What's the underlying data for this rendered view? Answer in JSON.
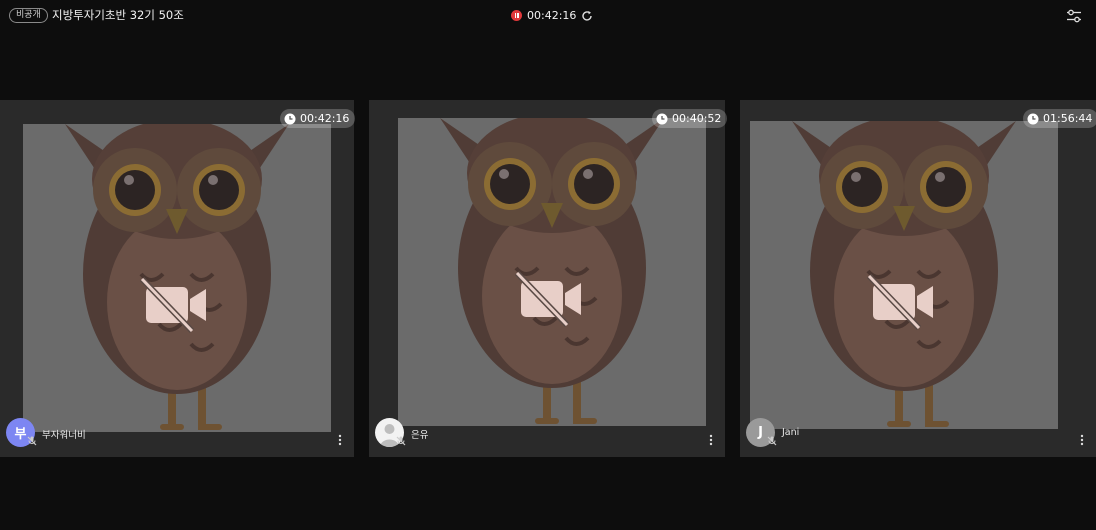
{
  "header": {
    "visibility_badge": "비공개",
    "room_title": "지방투자기초반 32기 50조",
    "recording_time": "00:42:16",
    "recording_color": "#e0383a"
  },
  "participants": [
    {
      "name": "부자워너비",
      "timer": "00:42:16",
      "avatar_letter": "부",
      "avatar_color": "#7d86f2",
      "camera": "off",
      "mic": "off"
    },
    {
      "name": "은유",
      "timer": "00:40:52",
      "avatar_letter": "",
      "avatar_color": "#f2f2f2",
      "camera": "off",
      "mic": "off"
    },
    {
      "name": "Jani",
      "timer": "01:56:44",
      "avatar_letter": "J",
      "avatar_color": "#9a9a9a",
      "camera": "off",
      "mic": "off"
    }
  ],
  "icons": {
    "settings": "sliders-icon",
    "refresh": "refresh-icon",
    "timer": "clock-icon",
    "camera": "camera-off-icon",
    "mic": "mic-off-icon",
    "more": "more-vertical-icon"
  }
}
